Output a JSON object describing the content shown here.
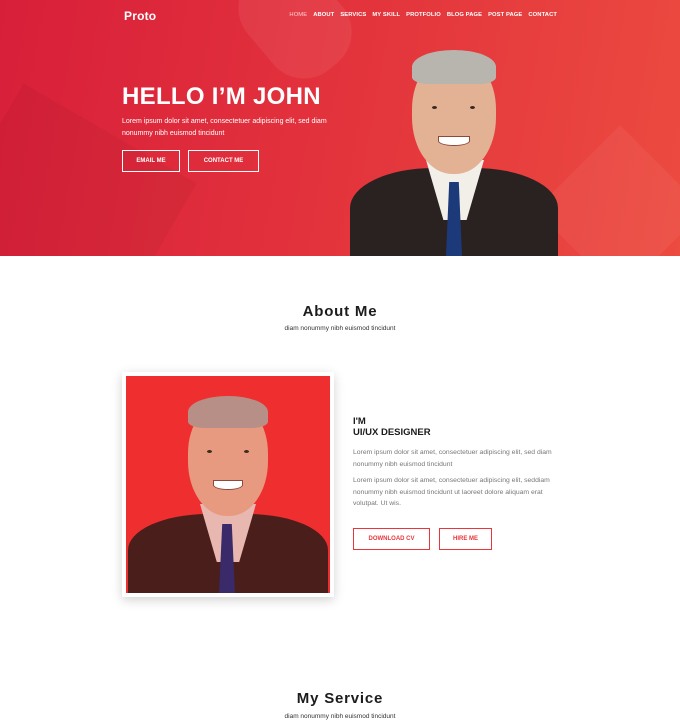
{
  "header": {
    "logo": "Proto",
    "nav": [
      {
        "label": "HOME",
        "active": true
      },
      {
        "label": "ABOUT",
        "active": false
      },
      {
        "label": "SERVICS",
        "active": false
      },
      {
        "label": "MY SKILL",
        "active": false
      },
      {
        "label": "PROTFOLIO",
        "active": false
      },
      {
        "label": "BLOG PAGE",
        "active": false
      },
      {
        "label": "POST PAGE",
        "active": false
      },
      {
        "label": "CONTACT",
        "active": false
      }
    ]
  },
  "hero": {
    "title": "HELLO I’M JOHN",
    "text": "Lorem ipsum dolor sit amet, consectetuer adipiscing elit, sed diam nonummy nibh euismod tincidunt",
    "email_button": "EMAIL ME",
    "contact_button": "CONTACT ME"
  },
  "about": {
    "title": "About Me",
    "subtitle": "diam nonummy nibh euismod tincidunt",
    "heading_line1": "I'M",
    "heading_line2": "UI/UX DESIGNER",
    "para1": "Lorem ipsum dolor sit amet, consectetuer adipiscing elit, sed diam nonummy nibh euismod tincidunt",
    "para2": "Lorem ipsum dolor sit amet, consectetuer adipiscing elit, seddiam nonummy nibh euismod tincidunt ut laoreet dolore aliquam erat volutpat. Ut wis.",
    "download_button": "DOWNLOAD CV",
    "hire_button": "HIRE ME"
  },
  "service": {
    "title": "My Service",
    "subtitle": "diam nonummy nibh euismod tincidunt"
  },
  "colors": {
    "brand_red": "#e2313c",
    "hero_gradient_start": "#d81f3a",
    "hero_gradient_end": "#ec4b40"
  }
}
